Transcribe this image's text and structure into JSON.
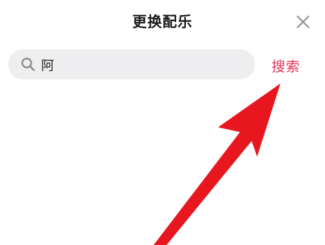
{
  "header": {
    "title": "更换配乐",
    "close_icon": "close-icon"
  },
  "search": {
    "value": "阿",
    "icon": "search-icon",
    "button_label": "搜索"
  },
  "colors": {
    "accent": "#e0345a",
    "arrow": "#e8161e",
    "search_bg": "#eeeef0"
  }
}
